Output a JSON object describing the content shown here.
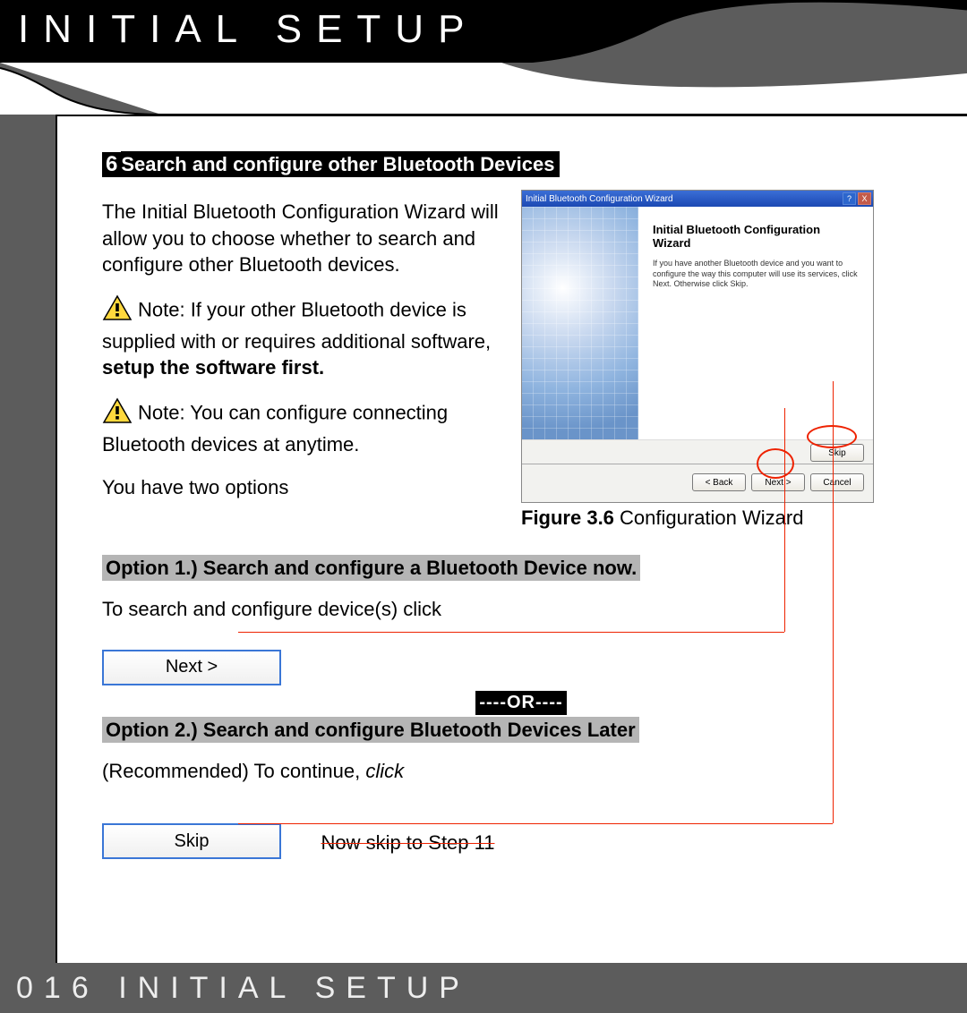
{
  "header": {
    "title": "Initial Setup"
  },
  "step": {
    "number": "6",
    "title": "Search and configure other Bluetooth Devices"
  },
  "intro": {
    "p1": "The Initial Bluetooth Configuration Wizard will allow you to choose whether to search and configure other Bluetooth devices.",
    "note1_prefix": "Note: If your other Bluetooth device is supplied with or requires additional software, ",
    "note1_bold": "setup the software first.",
    "note2": "Note: You can configure connecting Bluetooth devices at anytime.",
    "two_opts": "You have two options"
  },
  "wizard": {
    "titlebar": "Initial Bluetooth Configuration Wizard",
    "heading": "Initial Bluetooth Configuration Wizard",
    "body": "If you have another Bluetooth device and you want to configure the way this computer will use its services, click Next. Otherwise click Skip.",
    "skip": "Skip",
    "back": "< Back",
    "next": "Next >",
    "cancel": "Cancel"
  },
  "fig_caption_bold": "Figure 3.6",
  "fig_caption_rest": " Configuration Wizard",
  "option1": {
    "heading": "Option 1.) Search and configure a Bluetooth Device now.",
    "line": "To search and configure device(s) click",
    "button": "Next >"
  },
  "or": "----OR----",
  "option2": {
    "heading": "Option 2.) Search and configure Bluetooth Devices Later",
    "line_prefix": "(Recommended) To continue, ",
    "line_italic": "click",
    "button": "Skip",
    "skip_note": "Now skip to Step 11"
  },
  "footer": {
    "page": "016",
    "label": "Initial Setup"
  }
}
